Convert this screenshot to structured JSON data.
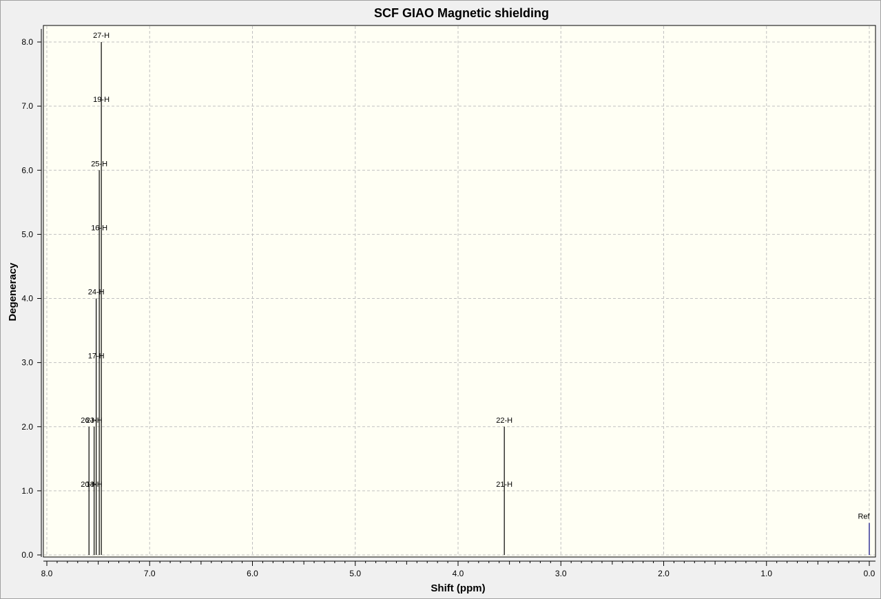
{
  "chart_data": {
    "type": "bar",
    "title": "SCF GIAO Magnetic shielding",
    "xlabel": "Shift (ppm)",
    "ylabel": "Degeneracy",
    "xlim": [
      8.0,
      0.0
    ],
    "ylim": [
      0.0,
      8.0
    ],
    "x_reversed": true,
    "grid": true,
    "xticks": [
      "8.0",
      "7.0",
      "6.0",
      "5.0",
      "4.0",
      "3.0",
      "2.0",
      "1.0",
      "0.0"
    ],
    "yticks": [
      "0.0",
      "1.0",
      "2.0",
      "3.0",
      "4.0",
      "5.0",
      "6.0",
      "7.0",
      "8.0"
    ],
    "peaks": [
      {
        "x": 7.59,
        "y": 2.0,
        "labels": [
          "20-H",
          "26-H"
        ]
      },
      {
        "x": 7.54,
        "y": 2.0,
        "labels": [
          "18-H",
          "23-H"
        ]
      },
      {
        "x": 7.52,
        "y": 4.0,
        "labels": [
          "17-H",
          "24-H"
        ]
      },
      {
        "x": 7.49,
        "y": 6.0,
        "labels": [
          "16-H",
          "25-H"
        ]
      },
      {
        "x": 7.47,
        "y": 8.0,
        "labels": [
          "19-H",
          "27-H"
        ]
      },
      {
        "x": 3.55,
        "y": 2.0,
        "labels": [
          "21-H",
          "22-H"
        ]
      }
    ],
    "reference": {
      "x": 0.0,
      "y": 0.5,
      "label": "Ref",
      "color": "#00007f"
    },
    "colors": {
      "plot_background": "#fffff4",
      "grid": "#c0c0c0",
      "peak": "#000000",
      "window_background": "#f0f0f0"
    }
  }
}
